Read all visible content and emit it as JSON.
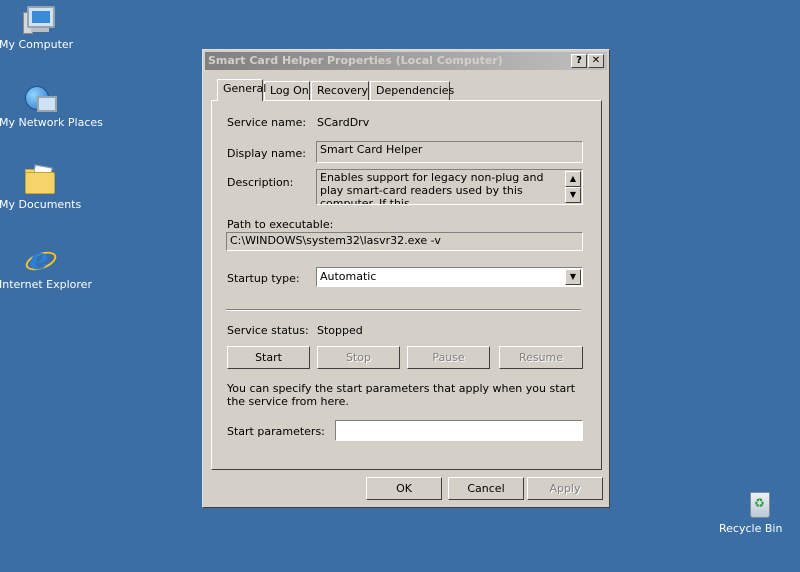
{
  "desktop": {
    "icons": [
      {
        "label": "My Computer"
      },
      {
        "label": "My Network Places"
      },
      {
        "label": "My Documents"
      },
      {
        "label": "Internet Explorer"
      },
      {
        "label": "Recycle Bin"
      }
    ]
  },
  "dialog": {
    "title": "Smart Card Helper Properties (Local Computer)",
    "help_glyph": "?",
    "close_glyph": "✕",
    "tabs": [
      "General",
      "Log On",
      "Recovery",
      "Dependencies"
    ],
    "active_tab": "General",
    "service_name_label": "Service name:",
    "service_name": "SCardDrv",
    "display_name_label": "Display name:",
    "display_name": "Smart Card Helper",
    "description_label": "Description:",
    "description": "Enables support for legacy non-plug and play smart-card readers used by this computer. If this",
    "path_label": "Path to executable:",
    "path": "C:\\WINDOWS\\system32\\lasvr32.exe -v",
    "startup_type_label": "Startup type:",
    "startup_type": "Automatic",
    "service_status_label": "Service status:",
    "service_status": "Stopped",
    "buttons": {
      "start": "Start",
      "stop": "Stop",
      "pause": "Pause",
      "resume": "Resume"
    },
    "info_text": "You can specify the start parameters that apply when you start the service from here.",
    "start_params_label": "Start parameters:",
    "start_params_value": "",
    "footer": {
      "ok": "OK",
      "cancel": "Cancel",
      "apply": "Apply"
    }
  }
}
